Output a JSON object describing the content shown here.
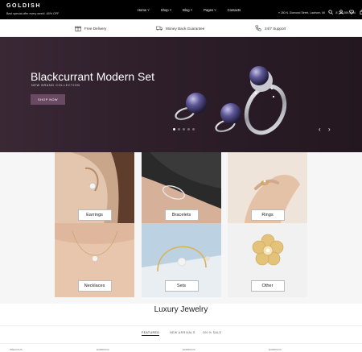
{
  "header": {
    "logo": "GOLDISH",
    "promo": "Best special offer every week! -60% OFF",
    "nav": [
      {
        "label": "Home ˅"
      },
      {
        "label": "Shop ˅"
      },
      {
        "label": "Blog ˅"
      },
      {
        "label": "Pages ˅"
      },
      {
        "label": "Contacts"
      }
    ],
    "address": "280 N. Diamond Street, Lawhorn, MI",
    "phone": "738-559-9994",
    "icons": [
      "search-icon",
      "user-icon",
      "heart-icon",
      "cart-icon"
    ]
  },
  "features": [
    {
      "label": "Free Delivery",
      "icon": "gift-icon"
    },
    {
      "label": "Money Back Guarantee",
      "icon": "truck-icon"
    },
    {
      "label": "24/7 Support",
      "icon": "phone-icon"
    }
  ],
  "hero": {
    "title": "Blackcurrant Modern Set",
    "subtitle": "NEW BRAND COLLECTION",
    "button": "SHOP NOW",
    "prev": "‹",
    "next": "›"
  },
  "categories": [
    {
      "label": "Earrings"
    },
    {
      "label": "Bracelets"
    },
    {
      "label": "Rings"
    },
    {
      "label": "Necklaces"
    },
    {
      "label": "Sets"
    },
    {
      "label": "Other"
    }
  ],
  "luxury": {
    "title": "Luxury Jewelry",
    "tabs": [
      "FEATURED",
      "NEW ARRIVALS",
      "ON % SALE"
    ]
  },
  "bottom_labels": [
    "PRECIOUS",
    "EARRINGS",
    "EARRINGS",
    "EARRINGS"
  ],
  "colors": {
    "topbar": "#000000",
    "hero_bg": "#2e1f2b",
    "accent": "#6a4a63"
  }
}
